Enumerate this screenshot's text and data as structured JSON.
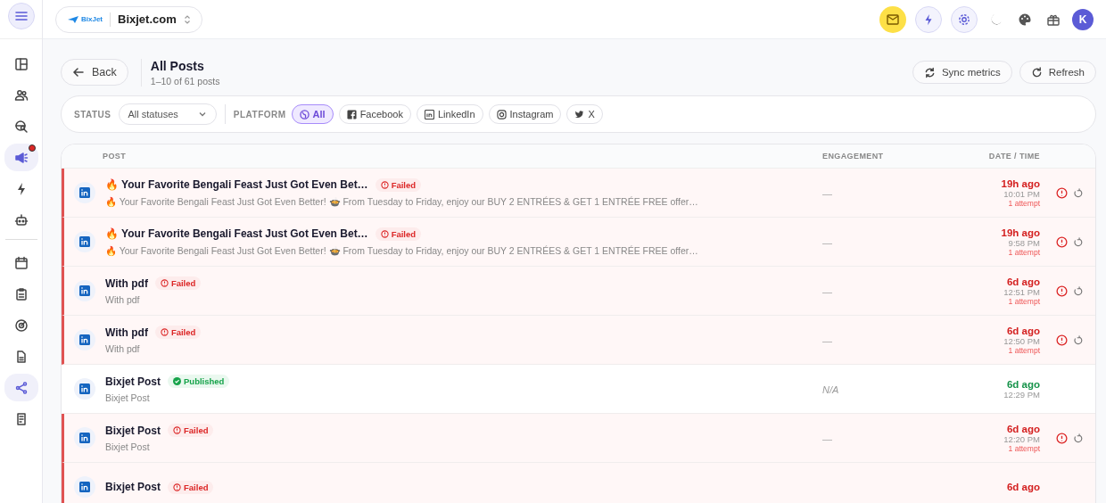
{
  "topbar": {
    "workspace": "Bixjet.com",
    "logo_text": "BixJet",
    "avatar": "K"
  },
  "sidebar": {
    "items": [
      {
        "selected": false,
        "badge": false
      },
      {
        "selected": false,
        "badge": false
      },
      {
        "selected": false,
        "badge": false
      },
      {
        "selected": true,
        "badge": true
      },
      {
        "selected": false,
        "badge": false
      },
      {
        "selected": false,
        "badge": false
      },
      {
        "selected": false,
        "badge": false
      },
      {
        "selected": false,
        "badge": false
      },
      {
        "selected": false,
        "badge": false
      },
      {
        "selected": false,
        "badge": false
      },
      {
        "selected": true,
        "badge": false
      },
      {
        "selected": false,
        "badge": false
      }
    ]
  },
  "header": {
    "back": "Back",
    "title": "All Posts",
    "subtitle": "1–10 of 61 posts",
    "actions": [
      "Sync metrics",
      "Refresh"
    ]
  },
  "filters": {
    "status_label": "STATUS",
    "status_value": "All statuses",
    "platform_label": "PLATFORM",
    "platforms": [
      {
        "label": "All",
        "selected": true
      },
      {
        "label": "Facebook",
        "selected": false
      },
      {
        "label": "LinkedIn",
        "selected": false
      },
      {
        "label": "Instagram",
        "selected": false
      },
      {
        "label": "X",
        "selected": false
      }
    ]
  },
  "table": {
    "columns": [
      "POST",
      "ENGAGEMENT",
      "DATE / TIME"
    ],
    "rows": [
      {
        "title": "🔥 Your Favorite Bengali Feast Just Got Even Bet…",
        "failed": true,
        "status_label": "Failed",
        "preview": "🔥 Your Favorite Bengali Feast Just Got Even Better! 🍲 From Tuesday to Friday, enjoy our BUY 2 ENTRÉES & GET 1 ENTRÉE FREE offer…",
        "engagement": "—",
        "ago": "19h ago",
        "time": "10:01 PM",
        "attempts": "1 attempt"
      },
      {
        "title": "🔥 Your Favorite Bengali Feast Just Got Even Bet…",
        "failed": true,
        "status_label": "Failed",
        "preview": "🔥 Your Favorite Bengali Feast Just Got Even Better! 🍲 From Tuesday to Friday, enjoy our BUY 2 ENTRÉES & GET 1 ENTRÉE FREE offer…",
        "engagement": "—",
        "ago": "19h ago",
        "time": "9:58 PM",
        "attempts": "1 attempt"
      },
      {
        "title": "With pdf",
        "failed": true,
        "status_label": "Failed",
        "preview": "With pdf",
        "engagement": "—",
        "ago": "6d ago",
        "time": "12:51 PM",
        "attempts": "1 attempt"
      },
      {
        "title": "With pdf",
        "failed": true,
        "status_label": "Failed",
        "preview": "With pdf",
        "engagement": "—",
        "ago": "6d ago",
        "time": "12:50 PM",
        "attempts": "1 attempt"
      },
      {
        "title": "Bixjet Post",
        "failed": false,
        "status_label": "Published",
        "preview": "Bixjet Post",
        "engagement": "N/A",
        "ago": "6d ago",
        "time": "12:29 PM"
      },
      {
        "title": "Bixjet Post",
        "failed": true,
        "status_label": "Failed",
        "preview": "Bixjet Post",
        "engagement": "—",
        "ago": "6d ago",
        "time": "12:20 PM",
        "attempts": "1 attempt"
      },
      {
        "title": "Bixjet Post",
        "failed": true,
        "status_label": "Failed",
        "ago": "6d ago"
      }
    ]
  }
}
